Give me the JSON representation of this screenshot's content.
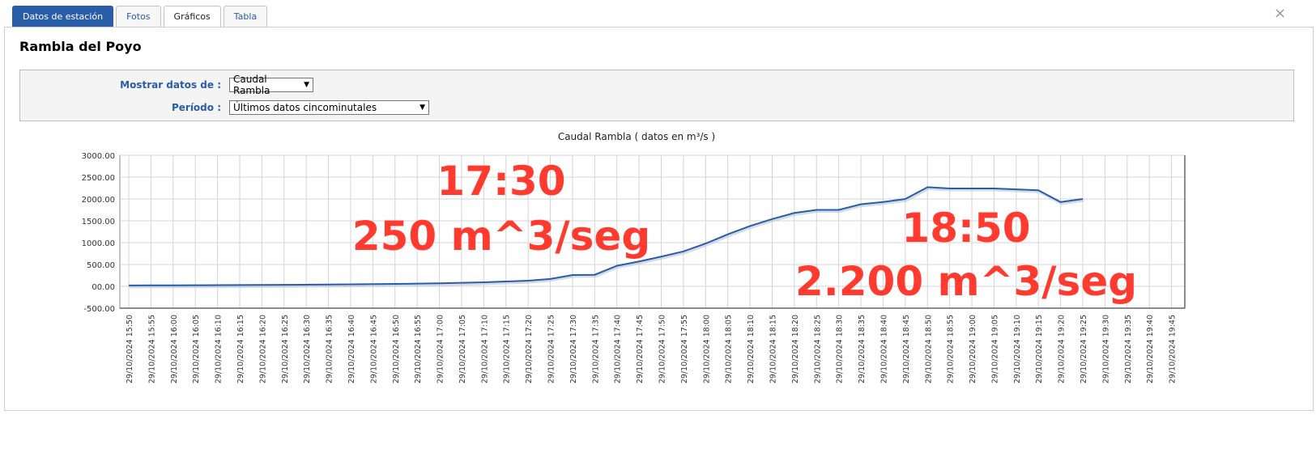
{
  "tabs": [
    {
      "label": "Datos de estación"
    },
    {
      "label": "Fotos"
    },
    {
      "label": "Gráficos"
    },
    {
      "label": "Tabla"
    }
  ],
  "close_symbol": "×",
  "station": {
    "name": "Rambla del Poyo"
  },
  "filters": {
    "data_label": "Mostrar datos de :",
    "data_value": "Caudal Rambla",
    "period_label": "Período :",
    "period_value": "Últimos datos cincominutales"
  },
  "annotations": [
    {
      "time": "17:30",
      "value": "250 m^3/seg"
    },
    {
      "time": "18:50",
      "value": "2.200 m^3/seg"
    }
  ],
  "colors": {
    "line": "#2a5da8",
    "annotation": "#ff3b30",
    "accent": "#2a5da8"
  },
  "chart_data": {
    "type": "line",
    "title": "Caudal Rambla ( datos en m³/s )",
    "ylim": [
      -500,
      3000
    ],
    "yticks": [
      "-500.00",
      "00.00",
      "500.00",
      "1000.00",
      "1500.00",
      "2000.00",
      "2500.00",
      "3000.00"
    ],
    "grid": true,
    "x": [
      "29/10/2024 15:50",
      "29/10/2024 15:55",
      "29/10/2024 16:00",
      "29/10/2024 16:05",
      "29/10/2024 16:10",
      "29/10/2024 16:15",
      "29/10/2024 16:20",
      "29/10/2024 16:25",
      "29/10/2024 16:30",
      "29/10/2024 16:35",
      "29/10/2024 16:40",
      "29/10/2024 16:45",
      "29/10/2024 16:50",
      "29/10/2024 16:55",
      "29/10/2024 17:00",
      "29/10/2024 17:05",
      "29/10/2024 17:10",
      "29/10/2024 17:15",
      "29/10/2024 17:20",
      "29/10/2024 17:25",
      "29/10/2024 17:30",
      "29/10/2024 17:35",
      "29/10/2024 17:40",
      "29/10/2024 17:45",
      "29/10/2024 17:50",
      "29/10/2024 17:55",
      "29/10/2024 18:00",
      "29/10/2024 18:05",
      "29/10/2024 18:10",
      "29/10/2024 18:15",
      "29/10/2024 18:20",
      "29/10/2024 18:25",
      "29/10/2024 18:30",
      "29/10/2024 18:35",
      "29/10/2024 18:40",
      "29/10/2024 18:45",
      "29/10/2024 18:50",
      "29/10/2024 18:55",
      "29/10/2024 19:00",
      "29/10/2024 19:05",
      "29/10/2024 19:10",
      "29/10/2024 19:15",
      "29/10/2024 19:20",
      "29/10/2024 19:25",
      "29/10/2024 19:30",
      "29/10/2024 19:35",
      "29/10/2024 19:40",
      "29/10/2024 19:45"
    ],
    "series": [
      {
        "values": [
          20,
          22,
          23,
          25,
          28,
          30,
          32,
          35,
          38,
          42,
          46,
          50,
          56,
          62,
          70,
          80,
          92,
          110,
          130,
          170,
          260,
          265,
          470,
          570,
          680,
          800,
          980,
          1190,
          1380,
          1540,
          1680,
          1750,
          1750,
          1880,
          1930,
          2000,
          2270,
          2240,
          2240,
          2240,
          2220,
          2200,
          1930,
          2000,
          null,
          null,
          null,
          null
        ]
      }
    ]
  }
}
